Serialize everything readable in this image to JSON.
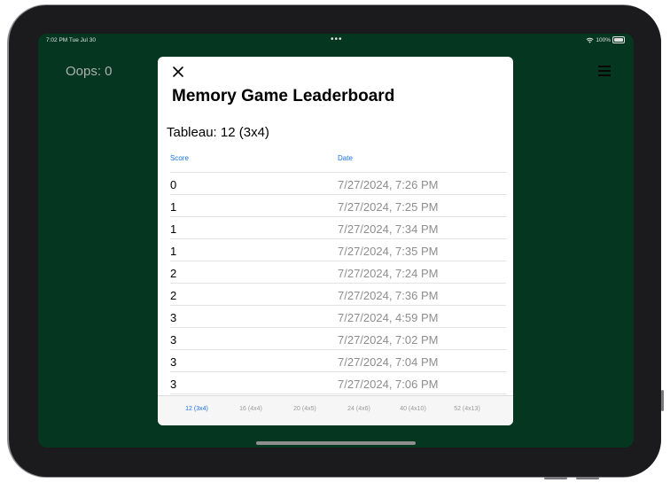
{
  "status_bar": {
    "time": "7:02 PM  Tue Jul 30",
    "dots": "•••",
    "battery": "100%"
  },
  "background": {
    "oops_label": "Oops: 0"
  },
  "modal": {
    "close_label": "✕",
    "title": "Memory Game Leaderboard",
    "tableau_label": "Tableau: 12 (3x4)",
    "columns": [
      "Score",
      "Date"
    ],
    "rows": [
      {
        "score": "0",
        "date": "7/27/2024, 7:26 PM"
      },
      {
        "score": "1",
        "date": "7/27/2024, 7:25 PM"
      },
      {
        "score": "1",
        "date": "7/27/2024, 7:34 PM"
      },
      {
        "score": "1",
        "date": "7/27/2024, 7:35 PM"
      },
      {
        "score": "2",
        "date": "7/27/2024, 7:24 PM"
      },
      {
        "score": "2",
        "date": "7/27/2024, 7:36 PM"
      },
      {
        "score": "3",
        "date": "7/27/2024, 4:59 PM"
      },
      {
        "score": "3",
        "date": "7/27/2024, 7:02 PM"
      },
      {
        "score": "3",
        "date": "7/27/2024, 7:04 PM"
      },
      {
        "score": "3",
        "date": "7/27/2024, 7:06 PM"
      }
    ],
    "tabs": [
      {
        "label": "12 (3x4)",
        "active": true
      },
      {
        "label": "16 (4x4)",
        "active": false
      },
      {
        "label": "20 (4x5)",
        "active": false
      },
      {
        "label": "24 (4x6)",
        "active": false
      },
      {
        "label": "40 (4x10)",
        "active": false
      },
      {
        "label": "52 (4x13)",
        "active": false
      }
    ]
  },
  "colors": {
    "accent": "#1a73e8",
    "felt": "#063f25",
    "date_text": "#8e8e8e"
  },
  "icons": {
    "close": "close-icon",
    "menu": "hamburger-menu-icon",
    "wifi": "wifi-icon",
    "battery": "battery-icon"
  }
}
